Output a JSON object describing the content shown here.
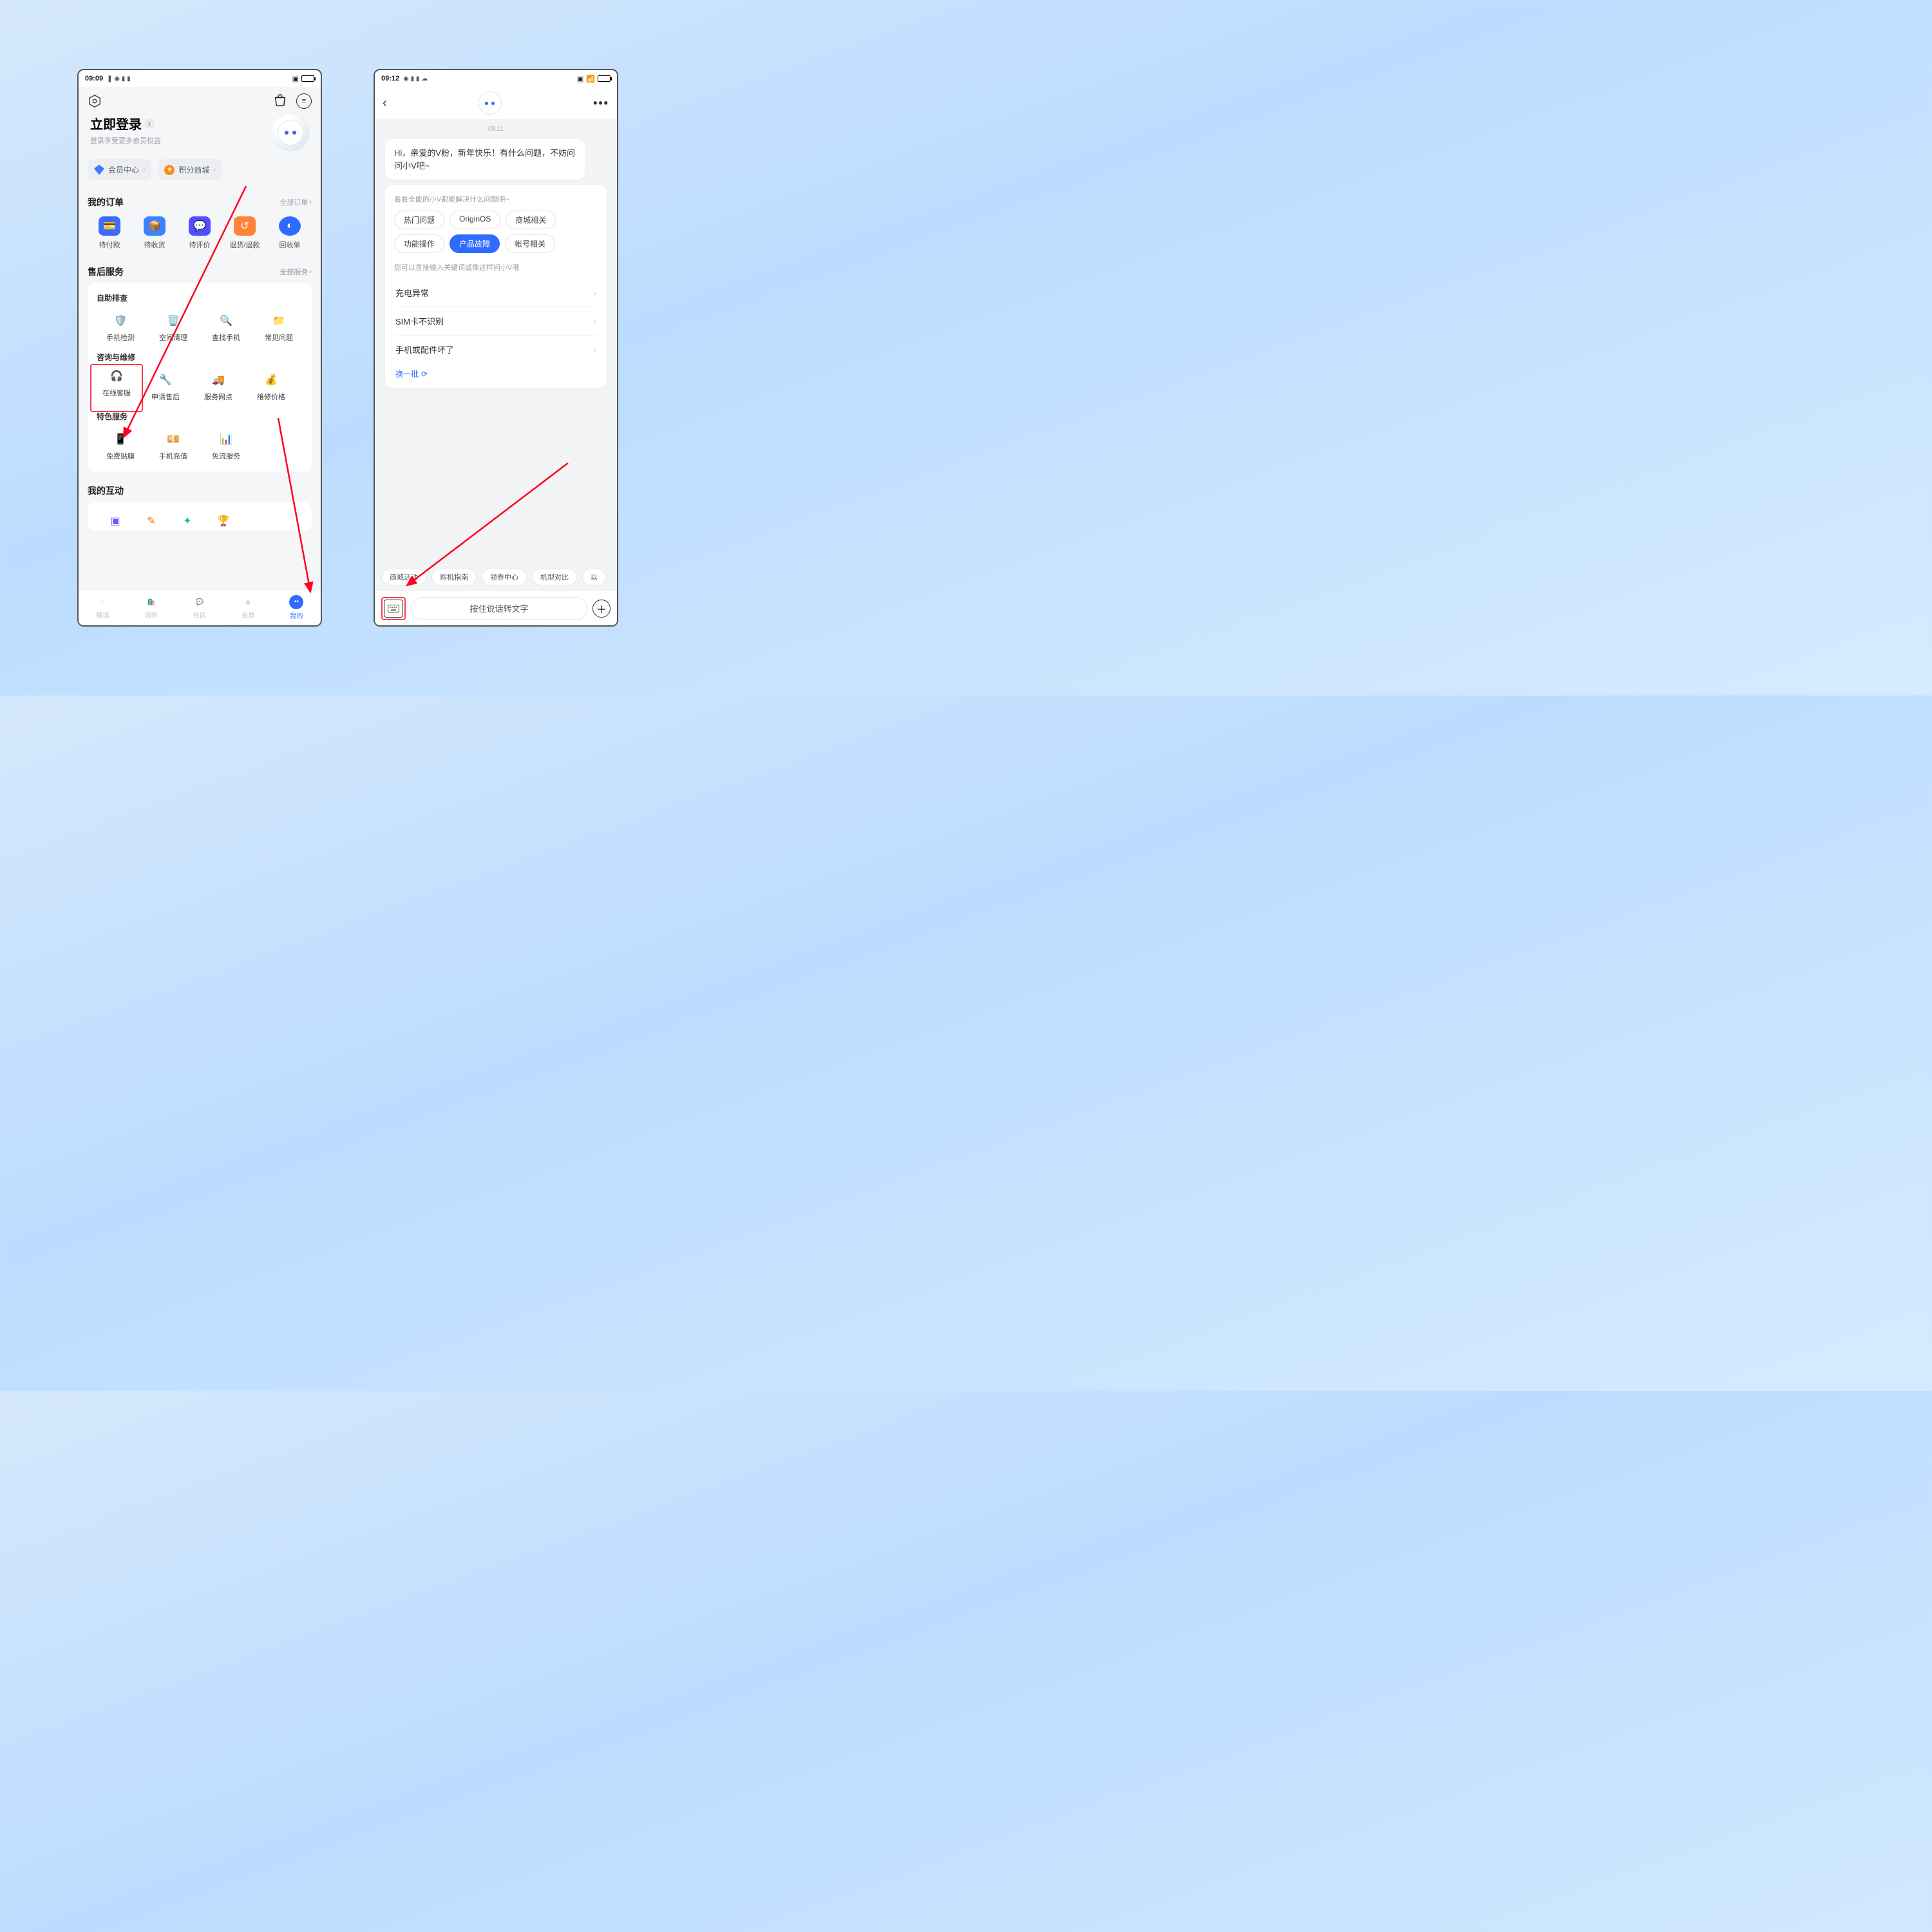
{
  "left": {
    "status_time": "09:09",
    "login_title": "立即登录",
    "login_sub": "登录享受更多会员权益",
    "pill_member": "会员中心",
    "pill_points": "积分商城",
    "orders_title": "我的订单",
    "orders_link": "全部订单",
    "orders": [
      "待付款",
      "待收货",
      "待评价",
      "退货/退款",
      "回收单"
    ],
    "after_title": "售后服务",
    "after_link": "全部服务",
    "self_title": "自助排查",
    "self_items": [
      "手机检测",
      "空间清理",
      "查找手机",
      "常见问题"
    ],
    "consult_title": "咨询与维修",
    "consult_items": [
      "在线客服",
      "申请售后",
      "服务网点",
      "维修价格"
    ],
    "special_title": "特色服务",
    "special_items": [
      "免费贴膜",
      "手机充值",
      "免流服务"
    ],
    "interact_title": "我的互动",
    "nav": [
      "精选",
      "选购",
      "社区",
      "会员",
      "我的"
    ]
  },
  "right": {
    "status_time": "09:12",
    "msg_time": "09:11",
    "greeting": "Hi，亲爱的V粉，新年快乐！有什么问题，不妨问问小V吧~",
    "cat_head": "看看全能的小V都能解决什么问题吧~",
    "cats": [
      "热门问题",
      "OriginOS",
      "商城相关",
      "功能操作",
      "产品故障",
      "帐号相关"
    ],
    "cat_active_index": 4,
    "hint": "您可以直接输入关键词或像这样问小V哦",
    "questions": [
      "充电异常",
      "SIM卡不识别",
      "手机或配件坏了"
    ],
    "refresh": "换一批",
    "suggestions": [
      "商城活动",
      "购机指南",
      "领券中心",
      "机型对比",
      "以"
    ],
    "voice": "按住说话转文字"
  }
}
